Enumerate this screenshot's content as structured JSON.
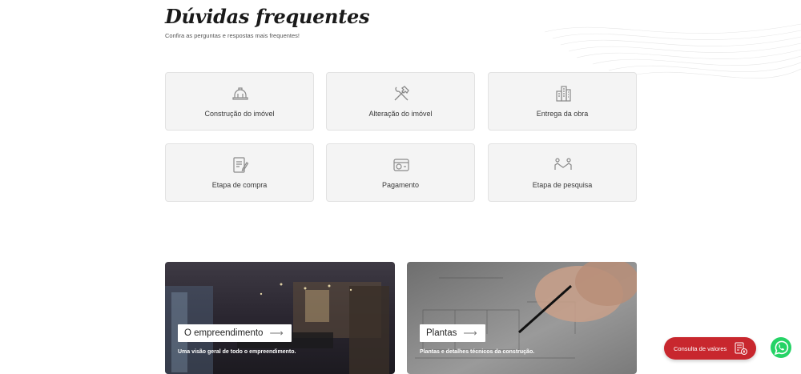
{
  "faq": {
    "title": "Dúvidas frequentes",
    "subtitle": "Confira as perguntas e respostas mais frequentes!",
    "cards": [
      {
        "label": "Construção do imóvel",
        "icon": "hard-hat-icon"
      },
      {
        "label": "Alteração do imóvel",
        "icon": "tools-icon"
      },
      {
        "label": "Entrega da obra",
        "icon": "buildings-icon"
      },
      {
        "label": "Etapa de compra",
        "icon": "contract-icon"
      },
      {
        "label": "Pagamento",
        "icon": "payment-icon"
      },
      {
        "label": "Etapa de pesquisa",
        "icon": "handshake-icon"
      }
    ]
  },
  "promos": [
    {
      "button": "O empreendimento",
      "description": "Uma visão geral de todo o empreendimento."
    },
    {
      "button": "Plantas",
      "description": "Plantas e detalhes técnicos da construção."
    }
  ],
  "floating": {
    "consulta_label": "Consulta de valores",
    "consulta_icon": "price-list-icon",
    "whatsapp_icon": "whatsapp-icon"
  },
  "colors": {
    "accent_red": "#c8272e",
    "whatsapp_green": "#25d366",
    "card_bg": "#f4f4f4"
  }
}
